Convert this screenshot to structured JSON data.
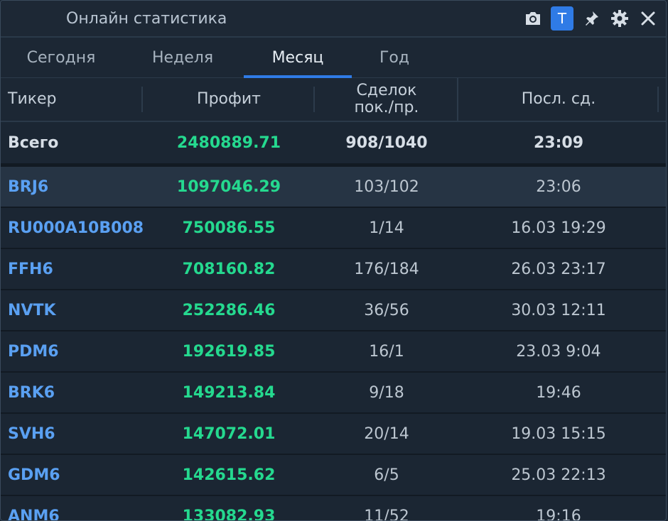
{
  "window": {
    "title": "Онлайн статистика"
  },
  "toolbar": {
    "icons": [
      "camera-icon",
      "t-toggle",
      "pin-icon",
      "gear-icon",
      "close-icon"
    ],
    "t_label": "T"
  },
  "tabs": [
    {
      "label": "Сегодня"
    },
    {
      "label": "Неделя"
    },
    {
      "label": "Месяц",
      "active": true
    },
    {
      "label": "Год"
    }
  ],
  "table": {
    "headers": {
      "ticker": "Тикер",
      "profit": "Профит",
      "deals_line1": "Сделок",
      "deals_line2": "пок./пр.",
      "last": "Посл. сд."
    },
    "total": {
      "label": "Всего",
      "profit": "2480889.71",
      "deals": "908/1040",
      "last": "23:09"
    },
    "rows": [
      {
        "ticker": "BRJ6",
        "profit": "1097046.29",
        "deals": "103/102",
        "last": "23:06"
      },
      {
        "ticker": "RU000A10B008",
        "profit": "750086.55",
        "deals": "1/14",
        "last": "16.03 19:29"
      },
      {
        "ticker": "FFH6",
        "profit": "708160.82",
        "deals": "176/184",
        "last": "26.03 23:17"
      },
      {
        "ticker": "NVTK",
        "profit": "252286.46",
        "deals": "36/56",
        "last": "30.03 12:11"
      },
      {
        "ticker": "PDM6",
        "profit": "192619.85",
        "deals": "16/1",
        "last": "23.03 9:04"
      },
      {
        "ticker": "BRK6",
        "profit": "149213.84",
        "deals": "9/18",
        "last": "19:46"
      },
      {
        "ticker": "SVH6",
        "profit": "147072.01",
        "deals": "20/14",
        "last": "19.03 15:15"
      },
      {
        "ticker": "GDM6",
        "profit": "142615.62",
        "deals": "6/5",
        "last": "25.03 22:13"
      },
      {
        "ticker": "ANM6",
        "profit": "133082.93",
        "deals": "11/52",
        "last": "19:16"
      }
    ]
  }
}
